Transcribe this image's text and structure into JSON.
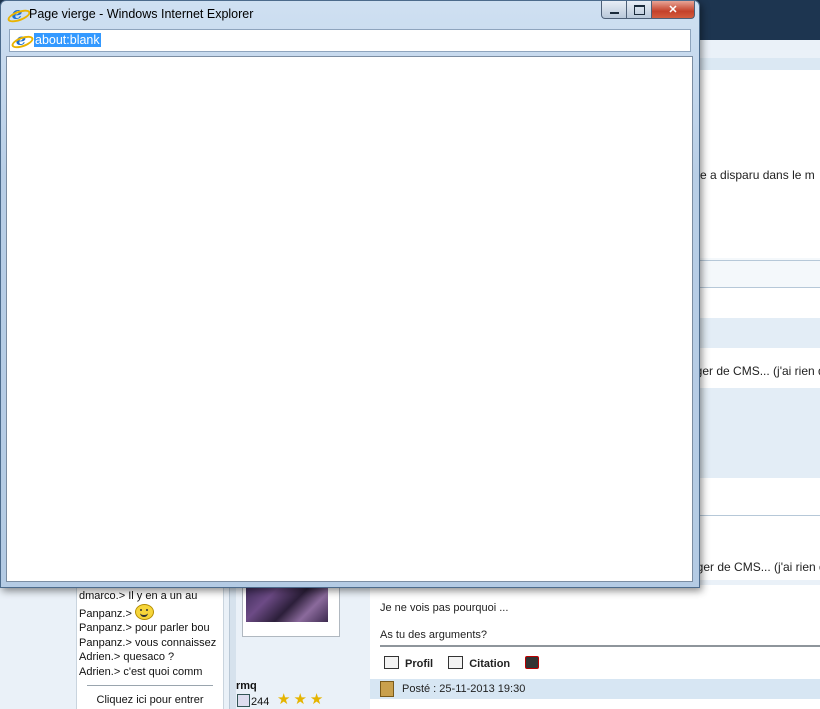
{
  "window": {
    "title": "Page vierge - Windows Internet Explorer",
    "address": "about:blank"
  },
  "background": {
    "snippets": {
      "s1": "site a disparu dans le m",
      "s2": "nger de CMS... (j'ai rien dit)",
      "s3": "nger de CMS... (j'ai rien d"
    },
    "chat": [
      {
        "user": "dmarco.>",
        "text": "Il y en a un au"
      },
      {
        "user": "Panpanz.>",
        "text": ""
      },
      {
        "user": "Panpanz.>",
        "text": "pour parler bou"
      },
      {
        "user": "Panpanz.>",
        "text": "vous connaissez"
      },
      {
        "user": "Adrien.>",
        "text": "quesaco ?"
      },
      {
        "user": "Adrien.>",
        "text": "c'est quoi comm"
      }
    ],
    "chat_link": "Cliquez ici pour entrer",
    "post": {
      "line1": "Je ne vois pas pourquoi ...",
      "line2": "As tu des arguments?",
      "profile_label": "Profil",
      "quote_label": "Citation",
      "posted": "Posté : 25-11-2013 19:30"
    },
    "author": {
      "username": "rmq",
      "post_count": "244",
      "stars": "★★★"
    }
  }
}
